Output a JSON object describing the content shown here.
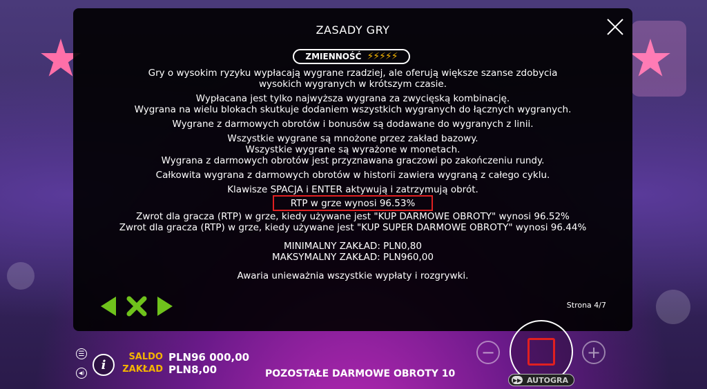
{
  "modal": {
    "title": "ZASADY GRY",
    "volatility_label": "ZMIENNOŚĆ",
    "volatility_bolts": "⚡⚡⚡⚡⚡",
    "lines": [
      "Gry o wysokim ryzyku wypłacają wygrane rzadziej, ale oferują większe szanse zdobycia",
      "wysokich wygranych w krótszym czasie.",
      "Wypłacana jest tylko najwyższa wygrana za zwycięską kombinację.",
      "Wygrana na wielu blokach skutkuje dodaniem wszystkich wygranych do łącznych wygranych.",
      "Wygrane z darmowych obrotów i bonusów są dodawane do wygranych z linii.",
      "Wszystkie wygrane są mnożone przez zakład bazowy.",
      "Wszystkie wygrane są wyrażone w monetach.",
      "Wygrana z darmowych obrotów jest przyznawana graczowi po zakończeniu rundy.",
      "Całkowita wygrana z darmowych obrotów w historii zawiera wygraną z całego cyklu.",
      "Klawisze SPACJA i ENTER aktywują i zatrzymują obrót.",
      "RTP w grze wynosi 96.53%",
      "Zwrot dla gracza (RTP) w grze, kiedy używane jest \"KUP DARMOWE OBROTY\" wynosi 96.52%",
      "Zwrot dla gracza (RTP) w grze, kiedy używane jest \"KUP SUPER DARMOWE OBROTY\" wynosi 96.44%",
      "MINIMALNY ZAKŁAD: PLN0,80",
      "MAKSYMALNY ZAKŁAD: PLN960,00",
      "Awaria unieważnia wszystkie wypłaty i rozgrywki."
    ],
    "page_indicator": "Strona 4/7"
  },
  "bottom": {
    "balance_label": "SALDO",
    "balance_value": "PLN96 000,00",
    "bet_label": "ZAKŁAD",
    "bet_value": "PLN8,00",
    "free_spins_text": "POZOSTAŁE DARMOWE OBROTY 10",
    "autoplay_label": "AUTOGRA",
    "minus": "−",
    "plus": "+",
    "menu_glyph": "☰",
    "sound_glyph": "◀)",
    "info_glyph": "i"
  },
  "colors": {
    "accent_yellow": "#f4b400",
    "nav_green": "#6fc21c",
    "highlight_red": "#e02020"
  },
  "icons": [
    "close-icon",
    "arrow-left-icon",
    "close-x-icon",
    "arrow-right-icon",
    "menu-icon",
    "sound-icon",
    "info-icon",
    "minus-icon",
    "plus-icon",
    "stop-icon",
    "autoplay-icon"
  ]
}
